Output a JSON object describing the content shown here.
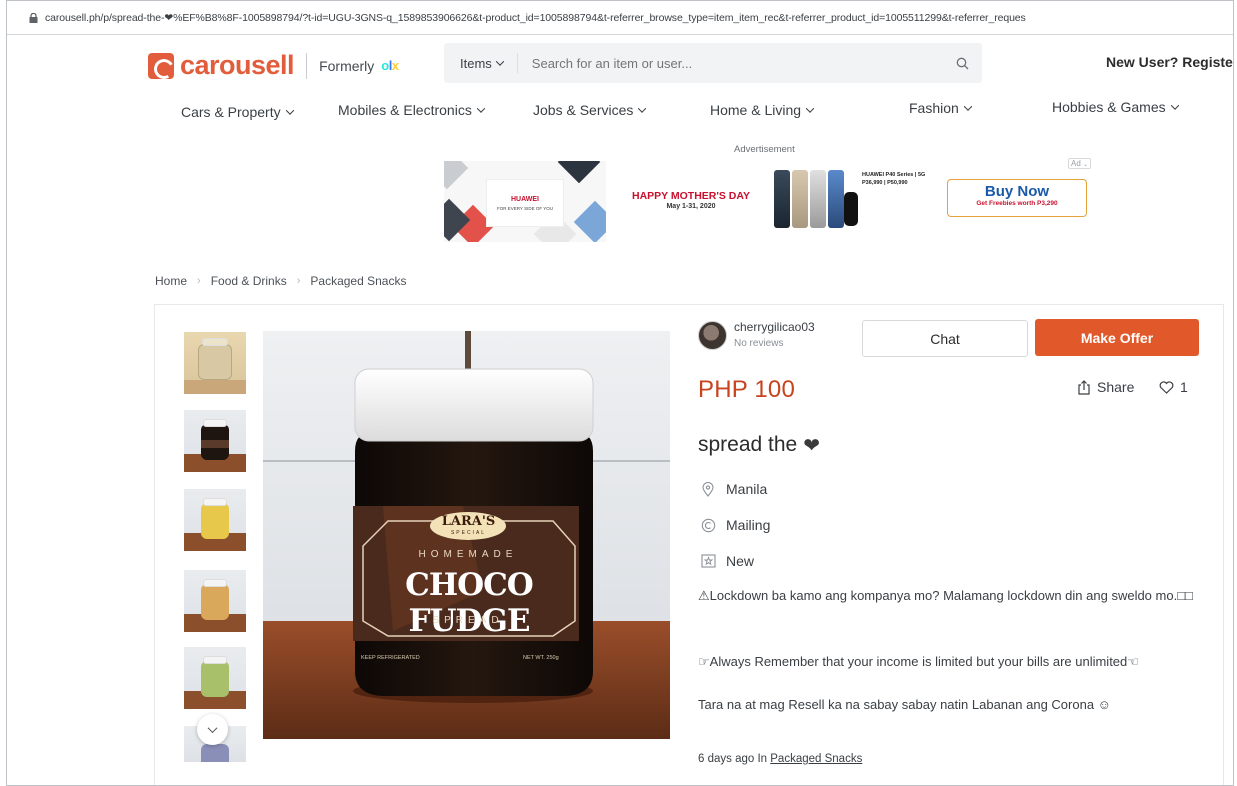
{
  "browser": {
    "url": "carousell.ph/p/spread-the-❤%EF%B8%8F-1005898794/?t-id=UGU-3GNS-q_1589853906626&t-product_id=1005898794&t-referrer_browse_type=item_item_rec&t-referrer_product_id=1005511299&t-referrer_reques"
  },
  "header": {
    "logo_text": "carousell",
    "formerly_text": "Formerly",
    "olx": {
      "o": "o",
      "l": "l",
      "x": "x"
    },
    "search": {
      "category": "Items",
      "placeholder": "Search for an item or user..."
    },
    "new_user_text": "New User? Register"
  },
  "categories": [
    {
      "label": "Cars & Property"
    },
    {
      "label": "Mobiles & Electronics"
    },
    {
      "label": "Jobs & Services"
    },
    {
      "label": "Home & Living"
    },
    {
      "label": "Fashion"
    },
    {
      "label": "Hobbies & Games"
    }
  ],
  "ad": {
    "label": "Advertisement",
    "brand": "HUAWEI",
    "tagline": "FOR EVERY SIDE OF YOU",
    "headline": "HAPPY MOTHER'S DAY",
    "dates": "May 1-31, 2020",
    "specs_line1": "HUAWEI P40 Series | 5G",
    "specs_line2": "P36,990 | P50,990",
    "cta": "Buy Now",
    "cta_sub": "Get Freebies worth P3,290",
    "ad_choice": "Ad"
  },
  "breadcrumb": [
    {
      "label": "Home"
    },
    {
      "label": "Food & Drinks"
    },
    {
      "label": "Packaged Snacks"
    }
  ],
  "listing": {
    "seller_name": "cherrygilicao03",
    "seller_reviews": "No reviews",
    "chat_label": "Chat",
    "offer_label": "Make Offer",
    "price": "PHP 100",
    "share_label": "Share",
    "like_count": "1",
    "title": "spread the",
    "title_emoji": "❤",
    "location": "Manila",
    "delivery": "Mailing",
    "condition": "New",
    "description": [
      "⚠Lockdown ba kamo ang kompanya mo? Malamang lockdown din ang sweldo mo.□□",
      "☞Always Remember that your income is limited but your bills are unlimited☜",
      "Tara na at mag Resell ka na sabay sabay natin Labanan ang Corona ☺"
    ],
    "posted": "6 days ago In",
    "posted_category": "Packaged Snacks",
    "label": {
      "brand_top": "LARA'S",
      "brand_sub": "SPECIAL",
      "homemade": "HOMEMADE",
      "product": "CHOCO FUDGE",
      "spread": "SPREAD",
      "keep": "KEEP REFRIGERATED",
      "net": "NET WT. 250g"
    }
  },
  "colors": {
    "brand": "#e25d3b",
    "offer_button": "#e1592b",
    "price": "#c8431e"
  }
}
